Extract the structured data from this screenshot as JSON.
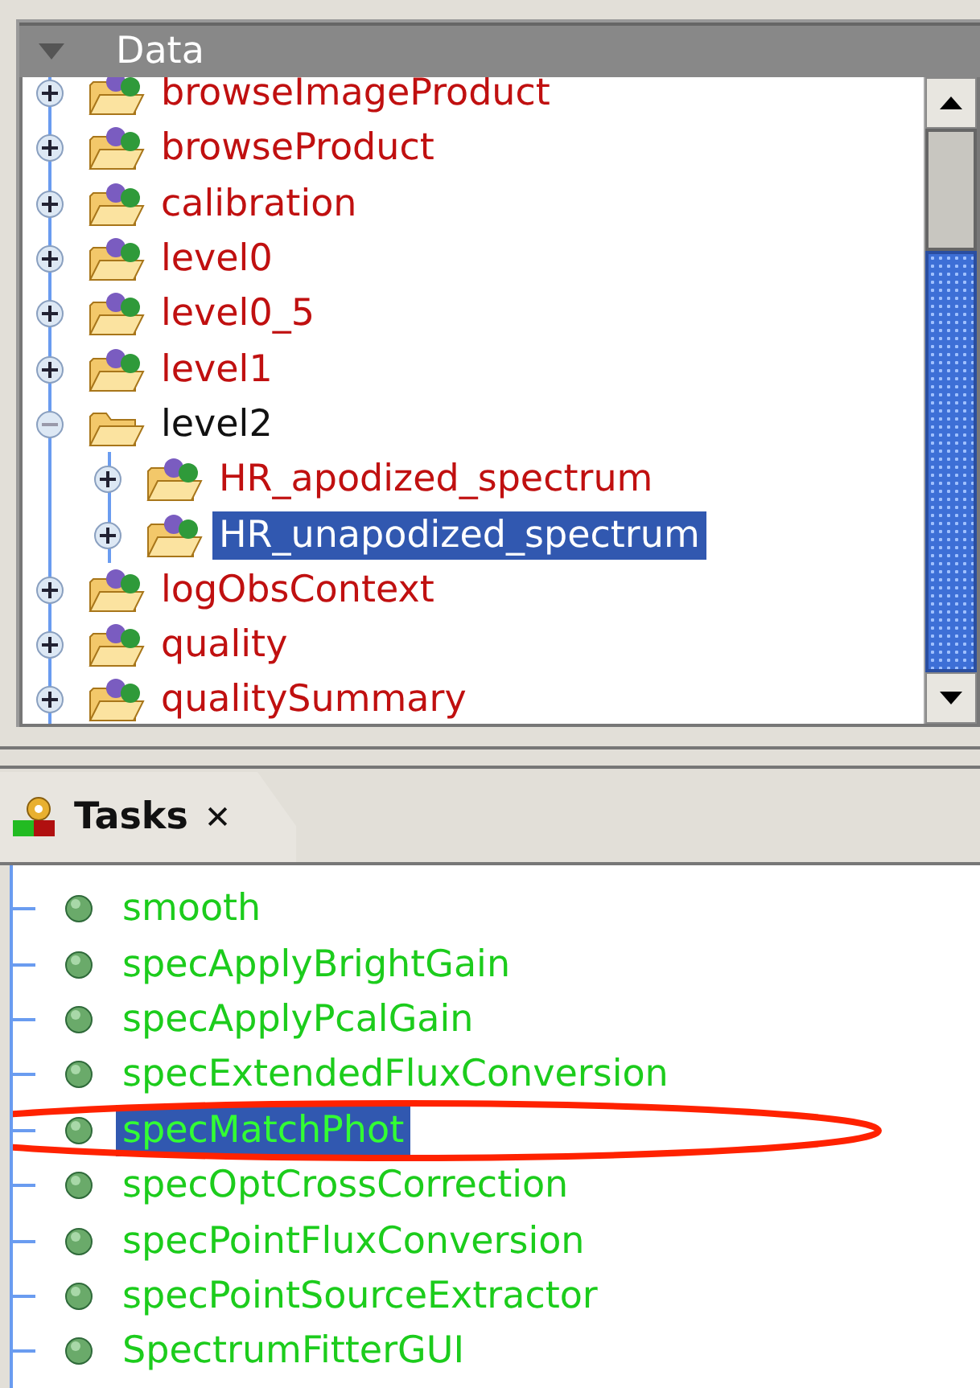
{
  "data_panel": {
    "title": "Data",
    "expanded": true,
    "tree": [
      {
        "label": "browseImageProduct",
        "kind": "product",
        "expanded": false,
        "selected": false
      },
      {
        "label": "browseProduct",
        "kind": "product",
        "expanded": false,
        "selected": false
      },
      {
        "label": "calibration",
        "kind": "product",
        "expanded": false,
        "selected": false
      },
      {
        "label": "level0",
        "kind": "product",
        "expanded": false,
        "selected": false
      },
      {
        "label": "level0_5",
        "kind": "product",
        "expanded": false,
        "selected": false
      },
      {
        "label": "level1",
        "kind": "product",
        "expanded": false,
        "selected": false
      },
      {
        "label": "level2",
        "kind": "folder",
        "expanded": true,
        "selected": false,
        "children": [
          {
            "label": "HR_apodized_spectrum",
            "kind": "product",
            "expanded": false,
            "selected": false
          },
          {
            "label": "HR_unapodized_spectrum",
            "kind": "product",
            "expanded": false,
            "selected": true
          }
        ]
      },
      {
        "label": "logObsContext",
        "kind": "product",
        "expanded": false,
        "selected": false
      },
      {
        "label": "quality",
        "kind": "product",
        "expanded": false,
        "selected": false
      },
      {
        "label": "qualitySummary",
        "kind": "product",
        "expanded": false,
        "selected": false
      }
    ]
  },
  "tasks_panel": {
    "tabs": [
      {
        "label": "Tasks",
        "selected": true,
        "close": "✕"
      }
    ],
    "items": [
      {
        "label": "smooth",
        "selected": false
      },
      {
        "label": "specApplyBrightGain",
        "selected": false
      },
      {
        "label": "specApplyPcalGain",
        "selected": false
      },
      {
        "label": "specExtendedFluxConversion",
        "selected": false
      },
      {
        "label": "specMatchPhot",
        "selected": true
      },
      {
        "label": "specOptCrossCorrection",
        "selected": false
      },
      {
        "label": "specPointFluxConversion",
        "selected": false
      },
      {
        "label": "specPointSourceExtractor",
        "selected": false
      },
      {
        "label": "SpectrumFitterGUI",
        "selected": false
      }
    ],
    "annotations": [
      {
        "kind": "ellipse",
        "color": "#ff2200"
      }
    ]
  }
}
